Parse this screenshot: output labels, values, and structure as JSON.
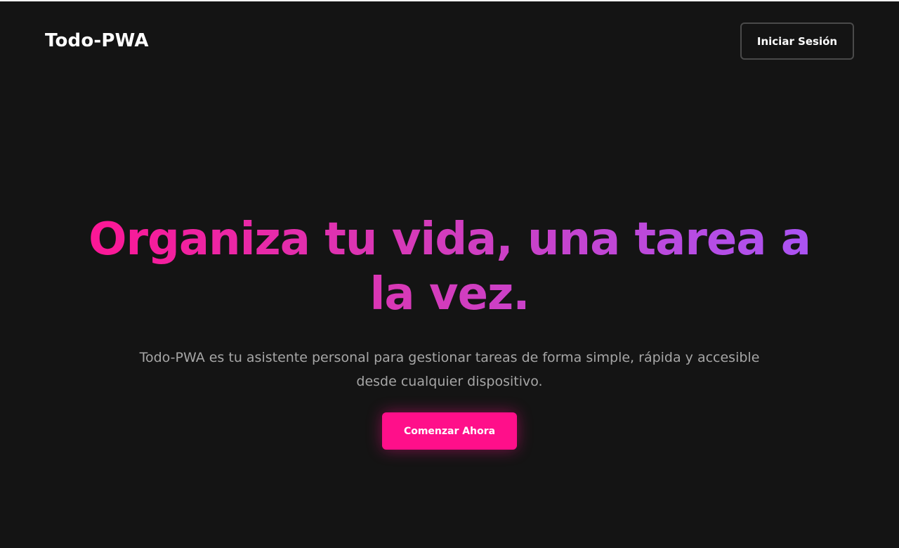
{
  "header": {
    "brand": "Todo-PWA",
    "login_label": "Iniciar Sesión"
  },
  "hero": {
    "title": "Organiza tu vida, una tarea a la vez.",
    "subtitle": "Todo-PWA es tu asistente personal para gestionar tareas de forma simple, rápida y accesible desde cualquier dispositivo.",
    "cta_label": "Comenzar Ahora"
  },
  "colors": {
    "background": "#141414",
    "accent_pink": "#ff0f8a",
    "gradient_start": "#ff1493",
    "gradient_end": "#a855f7",
    "subtitle_text": "#a6a6a6"
  }
}
